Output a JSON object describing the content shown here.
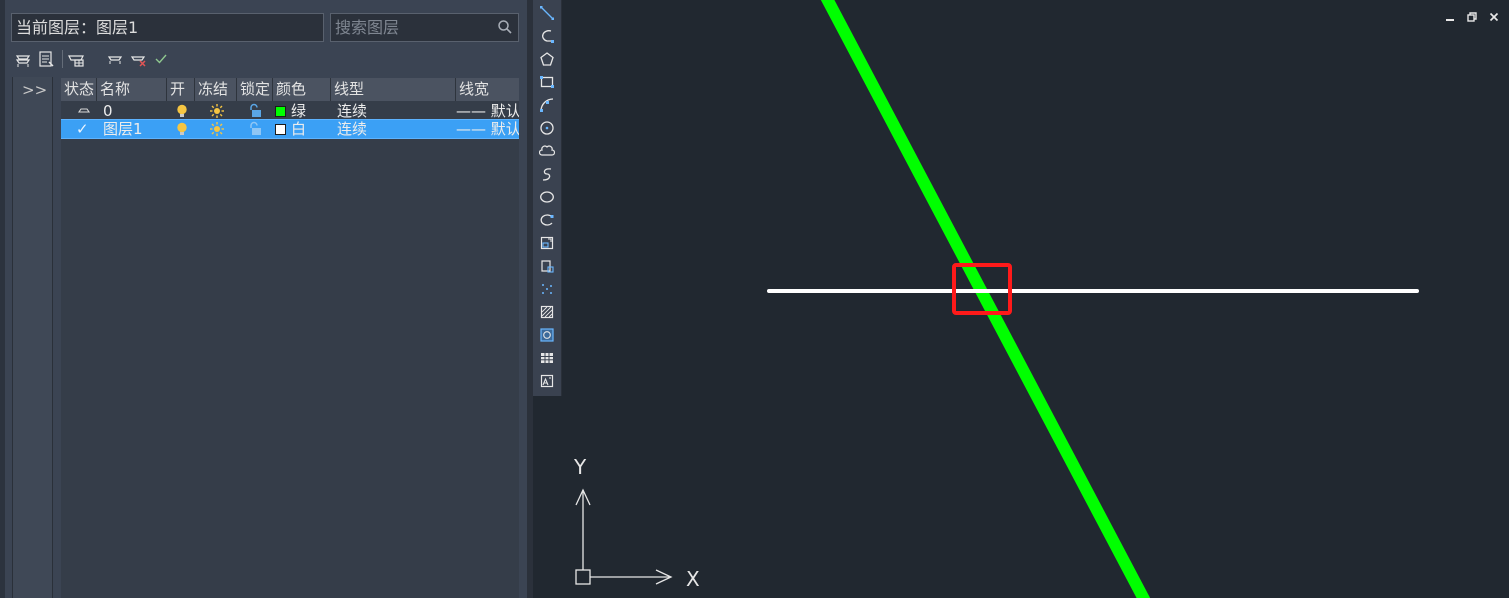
{
  "layer_panel": {
    "current_layer": "当前图层：图层1",
    "search": {
      "placeholder": "搜索图层",
      "value": ""
    },
    "toolbar": [
      "new-layer-icon",
      "layer-properties-icon",
      "layer-states-icon",
      "layer-prev-icon",
      "delete-layer-icon",
      "set-current-icon"
    ],
    "expander_label": ">>",
    "columns": [
      "状态",
      "名称",
      "开",
      "冻结",
      "锁定",
      "颜色",
      "线型",
      "线宽"
    ],
    "rows": [
      {
        "status": "",
        "name": "0",
        "on": true,
        "frozen": false,
        "locked": false,
        "color_name": "绿",
        "color_hex": "#00ff00",
        "linetype": "连续",
        "lineweight": "—— 默认",
        "selected": false,
        "current": false
      },
      {
        "status": "✓",
        "name": "图层1",
        "on": true,
        "frozen": false,
        "locked": false,
        "color_name": "白",
        "color_hex": "#ffffff",
        "linetype": "连续",
        "lineweight": "—— 默认",
        "selected": true,
        "current": true
      }
    ]
  },
  "draw_toolbar": [
    "line-icon",
    "polyline-icon",
    "polygon-icon",
    "rectangle-icon",
    "arc-icon",
    "circle-icon",
    "revision-cloud-icon",
    "spline-icon",
    "ellipse-icon",
    "ellipse-arc-icon",
    "insert-block-icon",
    "make-block-icon",
    "point-icon",
    "hatch-icon",
    "region-icon",
    "table-icon",
    "mtext-icon"
  ],
  "canvas": {
    "ucs": {
      "x_label": "X",
      "y_label": "Y"
    },
    "window_buttons": [
      "minimize-icon",
      "restore-icon",
      "close-icon"
    ],
    "colors": {
      "background": "#212830",
      "green_line": "#00ff00",
      "white_line": "#ffffff",
      "highlight": "#ff1a1a"
    }
  },
  "colors": {
    "panel_bg": "#3b4453",
    "selection": "#3ba0f5",
    "bulb": "#f5c542",
    "lock": "#5aa6e6"
  }
}
